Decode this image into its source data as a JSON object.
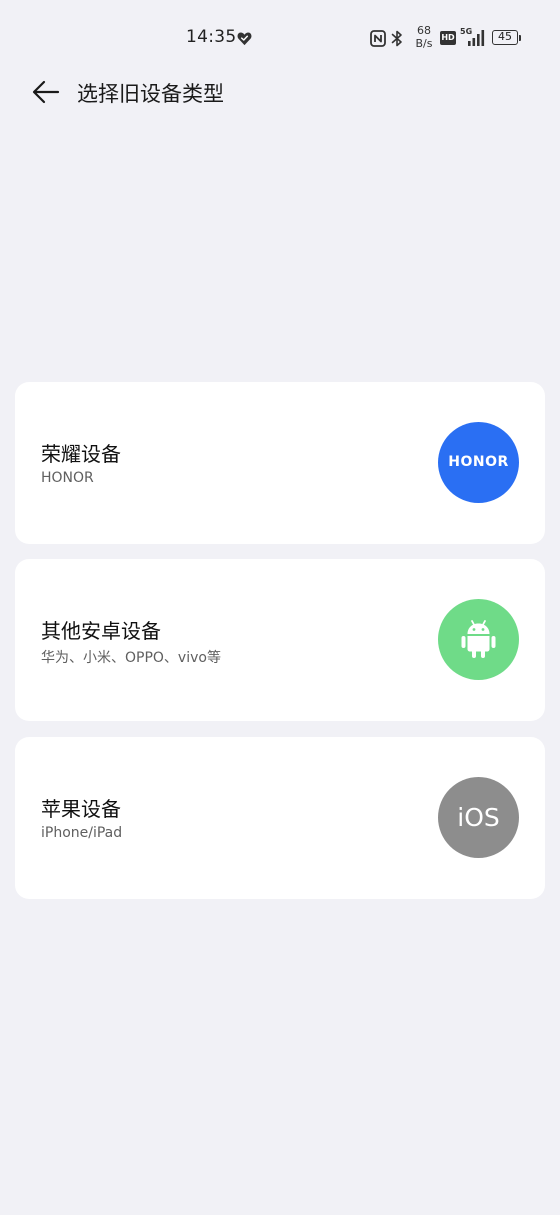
{
  "status_bar": {
    "time": "14:35",
    "net_speed_value": "68",
    "net_speed_unit": "B/s",
    "hd_label": "HD",
    "network_type": "5G",
    "battery_level": "45",
    "icons": [
      "heart-shield-icon",
      "nfc-icon",
      "bluetooth-icon",
      "signal-icon",
      "battery-icon"
    ]
  },
  "header": {
    "back_icon": "arrow-left-icon",
    "title": "选择旧设备类型"
  },
  "devices": [
    {
      "title": "荣耀设备",
      "subtitle": "HONOR",
      "badge_text": "HONOR",
      "badge_color": "#2a6ff3"
    },
    {
      "title": "其他安卓设备",
      "subtitle": "华为、小米、OPPO、vivo等",
      "badge_icon": "android-icon",
      "badge_color": "#6fdb88"
    },
    {
      "title": "苹果设备",
      "subtitle": "iPhone/iPad",
      "badge_text": "iOS",
      "badge_color": "#8d8d8d"
    }
  ]
}
